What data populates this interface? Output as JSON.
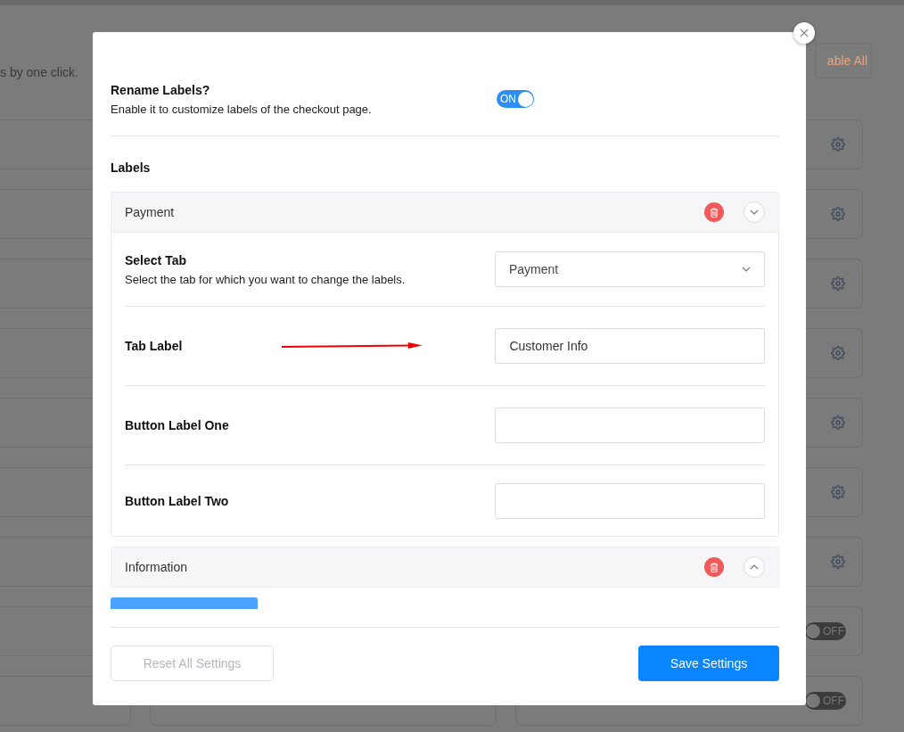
{
  "background": {
    "intro_text": "s by one click.",
    "enable_all_link": "able All",
    "rows": [
      {
        "kind": "gear"
      },
      {
        "kind": "gear"
      },
      {
        "kind": "gear"
      },
      {
        "kind": "gear"
      },
      {
        "kind": "gear"
      },
      {
        "kind": "gear"
      },
      {
        "kind": "gear"
      },
      {
        "kind": "toggle",
        "on": false,
        "label": "OFF"
      },
      {
        "kind": "toggle",
        "on": false,
        "label": "OFF"
      }
    ]
  },
  "modal": {
    "rename": {
      "title": "Rename Labels?",
      "description": "Enable it to customize labels of the checkout page.",
      "toggle": {
        "on": true,
        "label": "ON"
      }
    },
    "labels_heading": "Labels",
    "sections": [
      {
        "title": "Payment",
        "expanded": true,
        "fields": [
          {
            "kind": "select",
            "label": "Select Tab",
            "description": "Select the tab for which you want to change the labels.",
            "value": "Payment",
            "arrow": false
          },
          {
            "kind": "text",
            "label": "Tab Label",
            "value": "Customer Info",
            "arrow": true
          },
          {
            "kind": "text",
            "label": "Button Label One",
            "arrow": false
          },
          {
            "kind": "text",
            "label": "Button Label Two",
            "arrow": false
          }
        ]
      },
      {
        "title": "Information",
        "expanded": false
      }
    ],
    "footer": {
      "reset": {
        "label": "Reset All Settings",
        "disabled": true
      },
      "save": {
        "label": "Save Settings"
      }
    }
  }
}
